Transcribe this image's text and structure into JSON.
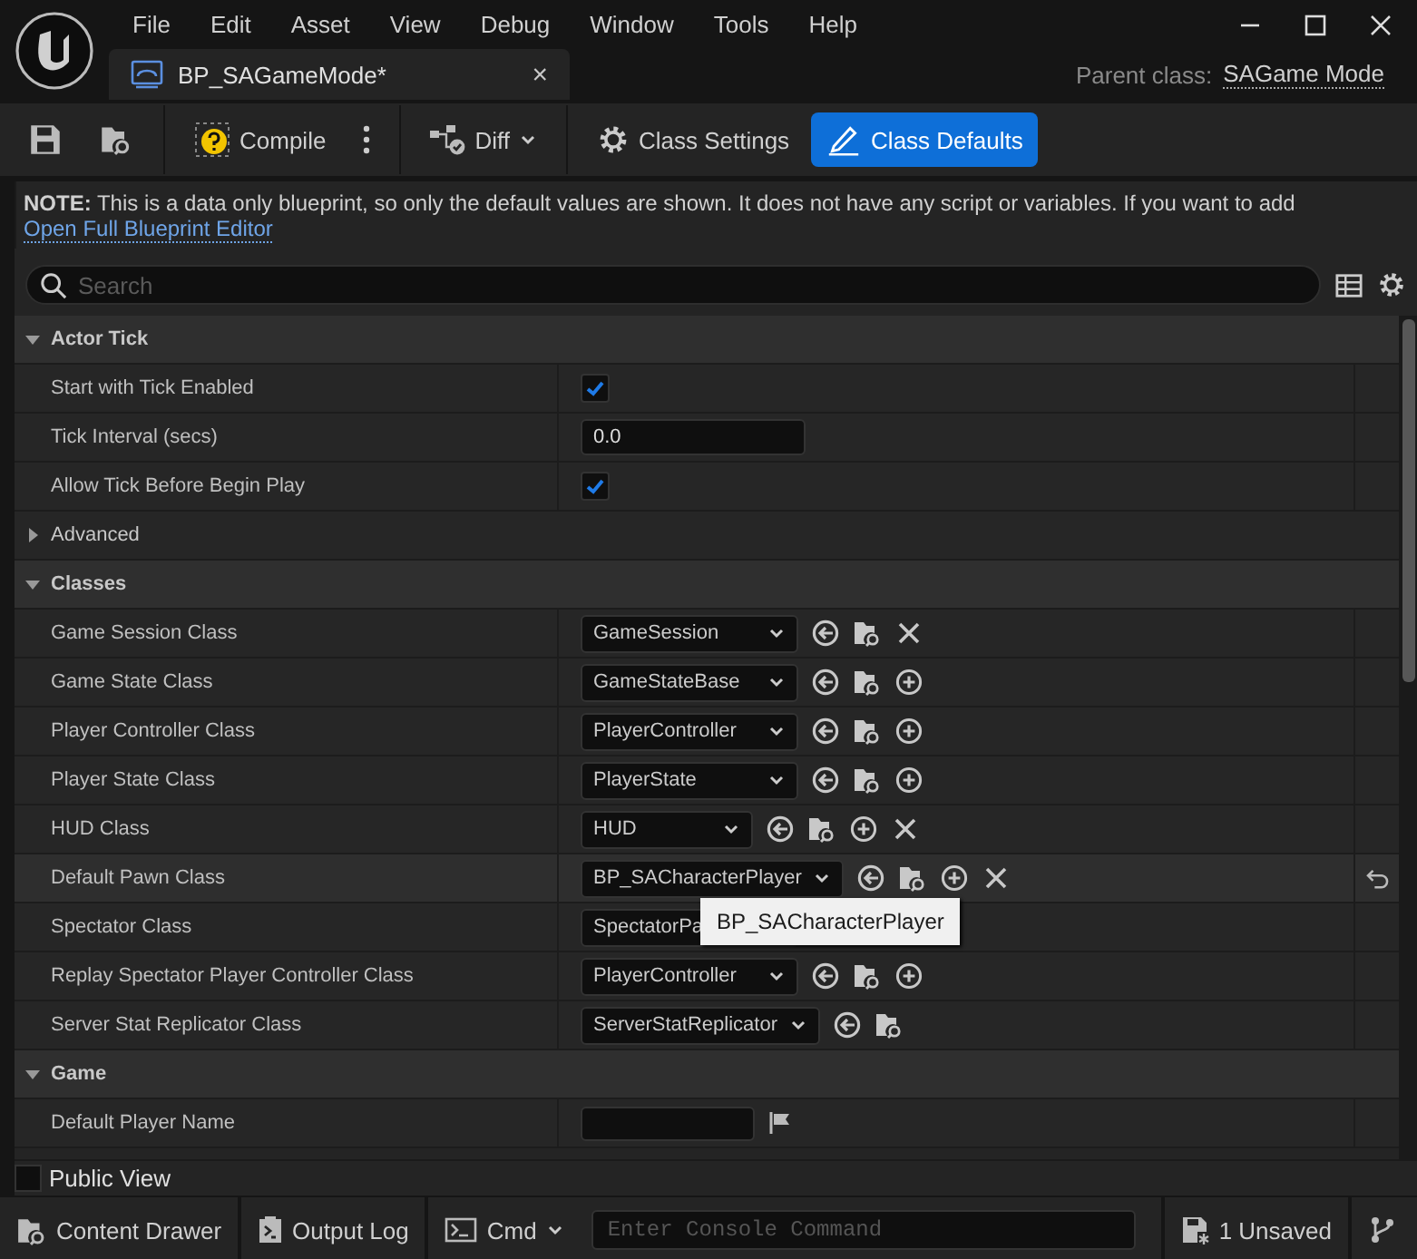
{
  "menu": [
    "File",
    "Edit",
    "Asset",
    "View",
    "Debug",
    "Window",
    "Tools",
    "Help"
  ],
  "document_tab": {
    "title": "BP_SAGameMode*",
    "close": "×"
  },
  "parent_class": {
    "label": "Parent class:",
    "value": "SAGame Mode"
  },
  "toolbar": [
    {
      "kind": "save"
    },
    {
      "kind": "browse"
    },
    {
      "kind": "compile",
      "label": "Compile"
    },
    {
      "kind": "more"
    },
    {
      "kind": "diff",
      "label": "Diff"
    },
    {
      "kind": "mode",
      "label": "Class Settings",
      "selected": false
    },
    {
      "kind": "mode",
      "label": "Class Defaults",
      "selected": true
    }
  ],
  "note": {
    "text": "**NOTE:** This is a data only blueprint, so only the default values are shown.  It does not have any script or variables.  If you want to add",
    "link": "Open Full Blueprint Editor"
  },
  "search": {
    "placeholder": "Search"
  },
  "sections": [
    {
      "title": "Actor Tick",
      "expanded": true,
      "rows": [
        {
          "kind": "checkbox",
          "label": "Start with Tick Enabled",
          "checked": true
        },
        {
          "kind": "number",
          "label": "Tick Interval (secs)",
          "value": "0.0"
        },
        {
          "kind": "checkbox",
          "label": "Allow Tick Before Begin Play",
          "checked": true
        }
      ]
    },
    {
      "title": "Advanced",
      "expanded": false
    },
    {
      "title": "Classes",
      "expanded": true,
      "rows": [
        {
          "kind": "class",
          "label": "Game Session Class",
          "value": "GameSession",
          "actions": [
            {
              "kind": "use"
            },
            {
              "kind": "browse"
            },
            {
              "kind": "clear"
            }
          ],
          "hovered": false,
          "reset": false
        },
        {
          "kind": "class",
          "label": "Game State Class",
          "value": "GameStateBase",
          "actions": [
            {
              "kind": "use"
            },
            {
              "kind": "browse"
            },
            {
              "kind": "add"
            }
          ],
          "hovered": false,
          "reset": false
        },
        {
          "kind": "class",
          "label": "Player Controller Class",
          "value": "PlayerController",
          "actions": [
            {
              "kind": "use"
            },
            {
              "kind": "browse"
            },
            {
              "kind": "add"
            }
          ],
          "hovered": false,
          "reset": false
        },
        {
          "kind": "class",
          "label": "Player State Class",
          "value": "PlayerState",
          "actions": [
            {
              "kind": "use"
            },
            {
              "kind": "browse"
            },
            {
              "kind": "add"
            }
          ],
          "hovered": false,
          "reset": false
        },
        {
          "kind": "class",
          "label": "HUD Class",
          "value": "HUD",
          "actions": [
            {
              "kind": "use"
            },
            {
              "kind": "browse"
            },
            {
              "kind": "add"
            },
            {
              "kind": "clear"
            }
          ],
          "hovered": false,
          "reset": false
        },
        {
          "kind": "class",
          "label": "Default Pawn Class",
          "value": "BP_SACharacterPlayer",
          "actions": [
            {
              "kind": "use"
            },
            {
              "kind": "browse"
            },
            {
              "kind": "add"
            },
            {
              "kind": "clear"
            }
          ],
          "hovered": true,
          "reset": true,
          "tooltip": "BP_SACharacterPlayer"
        },
        {
          "kind": "class",
          "label": "Spectator Class",
          "value": "SpectatorPa",
          "hovered": false,
          "reset": false
        },
        {
          "kind": "class",
          "label": "Replay Spectator Player Controller Class",
          "value": "PlayerController",
          "actions": [
            {
              "kind": "use"
            },
            {
              "kind": "browse"
            },
            {
              "kind": "add"
            }
          ],
          "hovered": false,
          "reset": false
        },
        {
          "kind": "class",
          "label": "Server Stat Replicator Class",
          "value": "ServerStatReplicator",
          "actions": [
            {
              "kind": "use"
            },
            {
              "kind": "browse"
            }
          ],
          "hovered": false,
          "reset": false
        }
      ]
    },
    {
      "title": "Game",
      "expanded": true,
      "rows": [
        {
          "kind": "text",
          "label": "Default Player Name"
        }
      ]
    }
  ],
  "public_view": {
    "label": "Public View",
    "checked": false
  },
  "status_bar": {
    "content_drawer": "Content Drawer",
    "output_log": "Output Log",
    "cmd": "Cmd",
    "console_placeholder": "Enter Console Command",
    "unsaved": "1 Unsaved"
  }
}
